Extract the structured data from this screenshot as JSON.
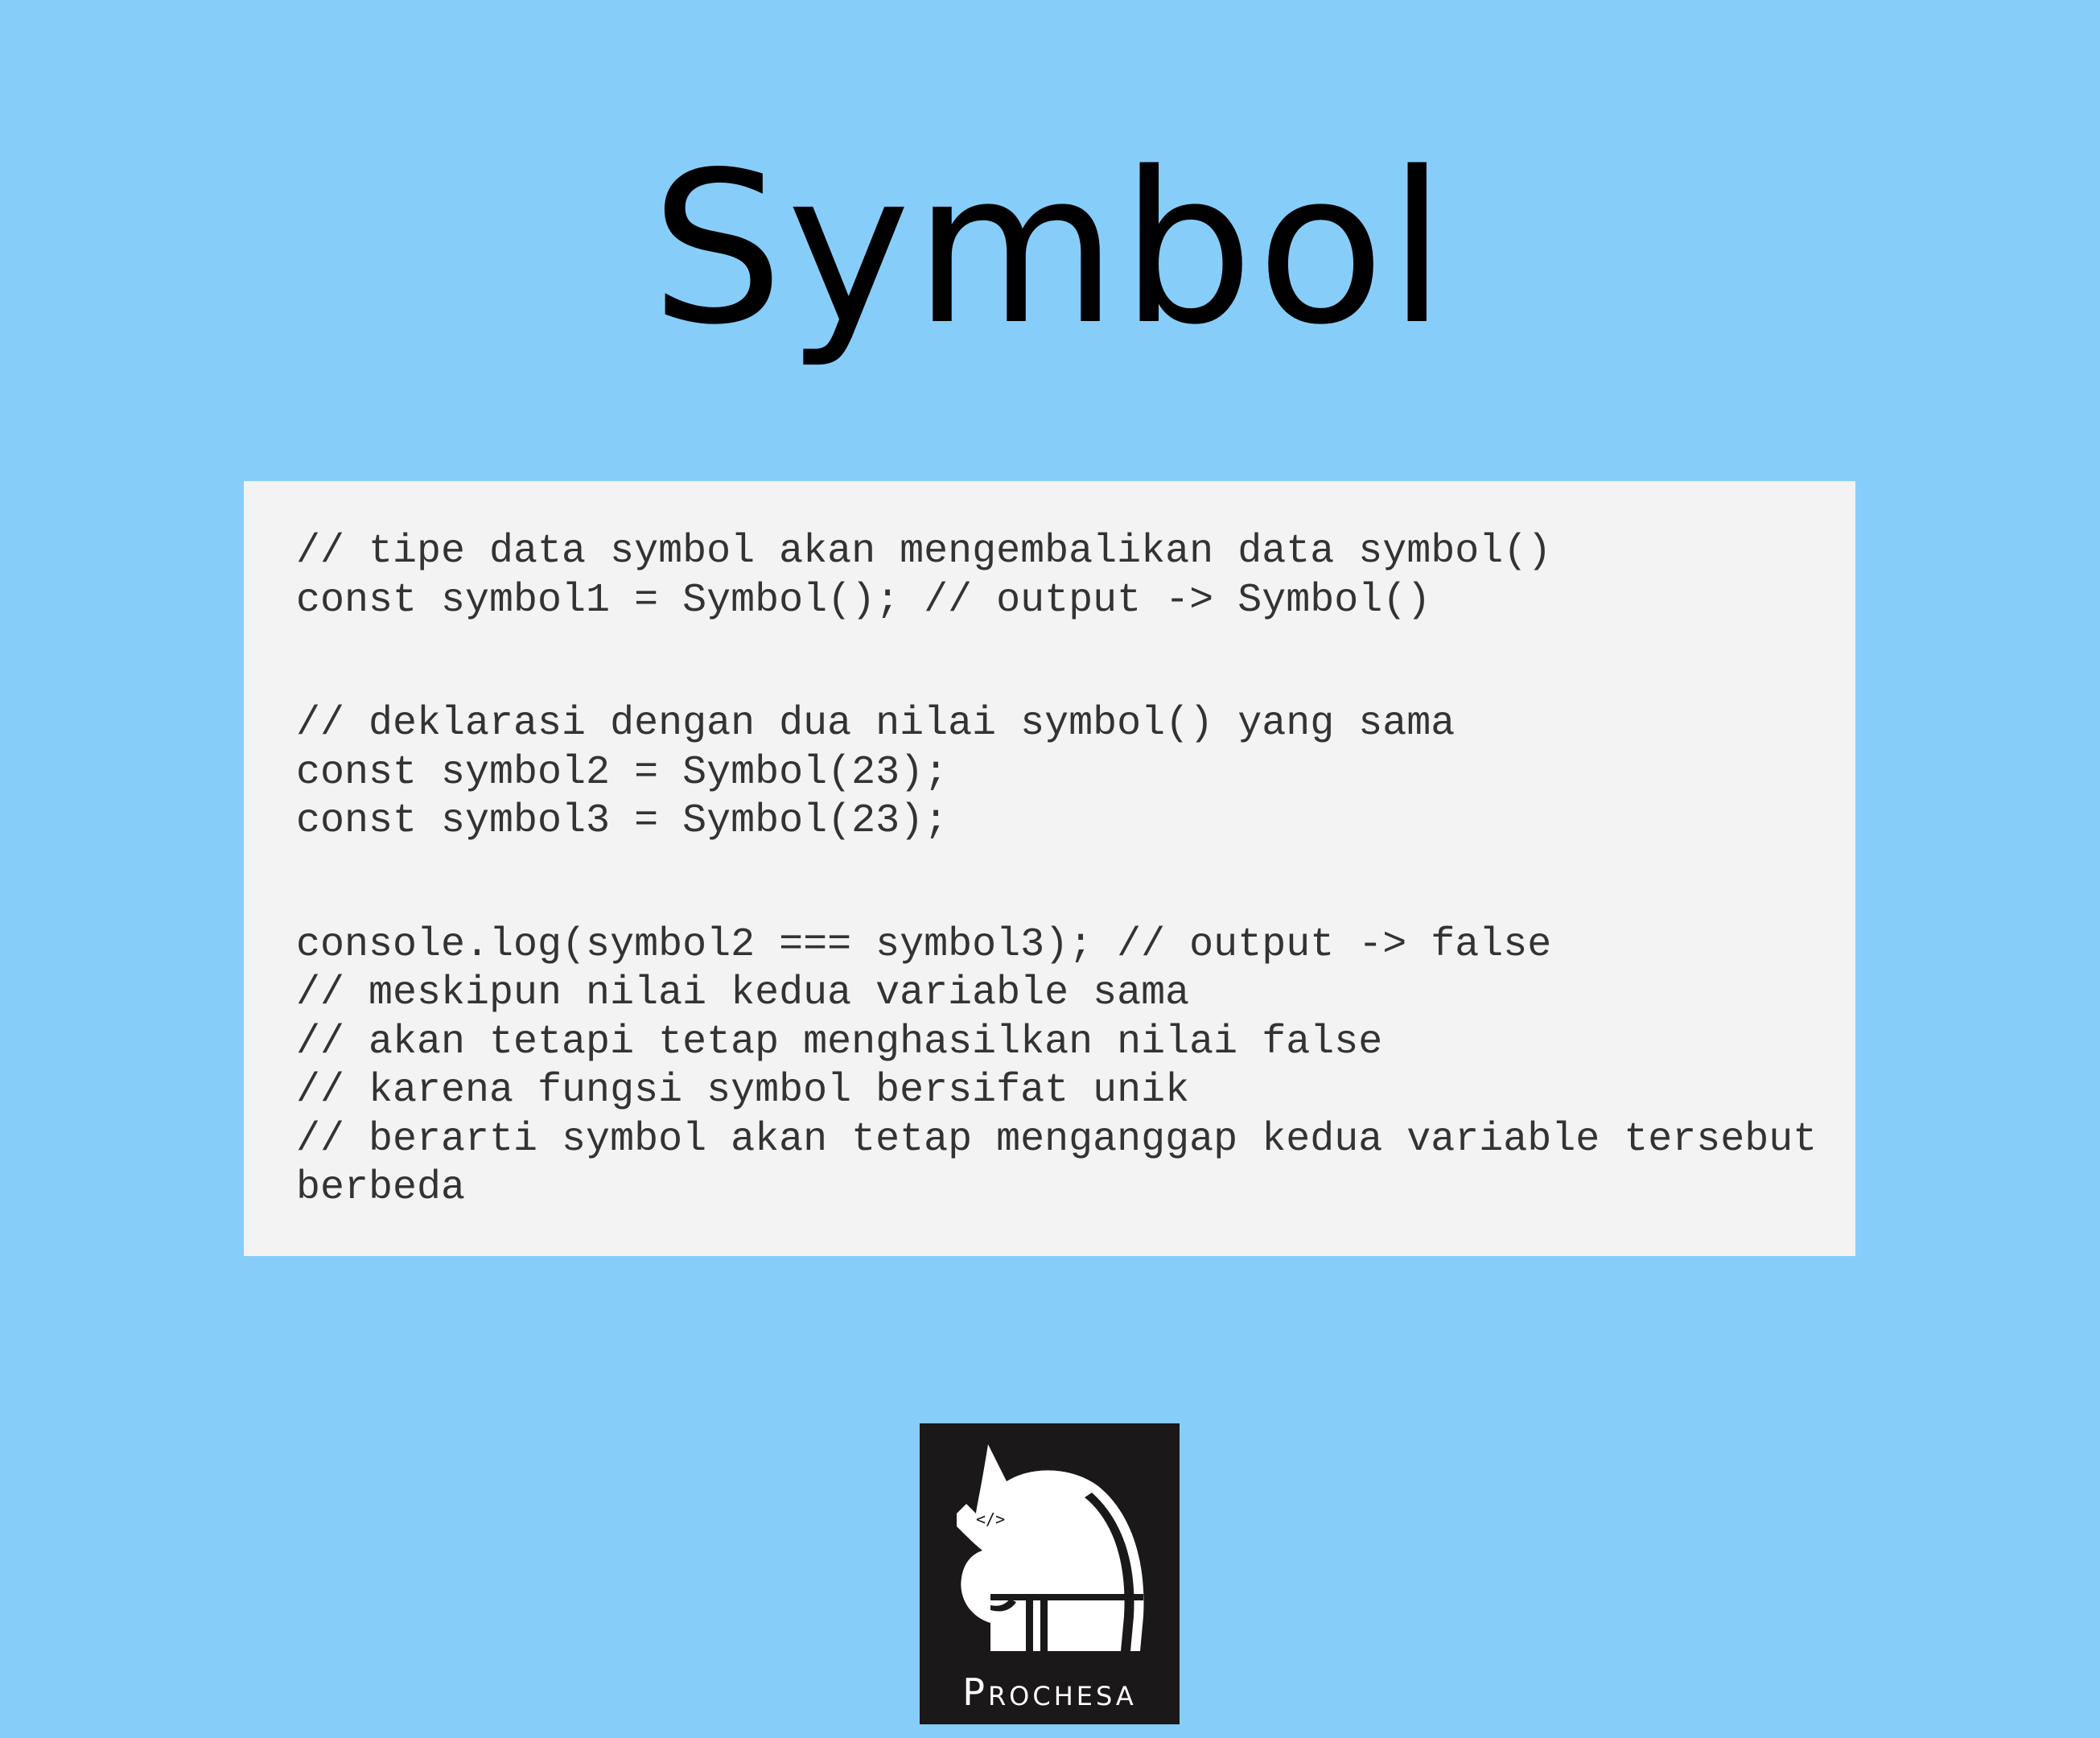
{
  "title": "Symbol",
  "code_block": {
    "lines": [
      "// tipe data symbol akan mengembalikan data symbol()",
      "const symbol1 = Symbol(); // output -> Symbol()",
      "// deklarasi dengan dua nilai symbol() yang sama",
      "const symbol2 = Symbol(23);",
      "const symbol3 = Symbol(23);",
      "console.log(symbol2 === symbol3); // output -> false",
      "// meskipun nilai kedua variable sama",
      "// akan tetapi tetap menghasilkan nilai false",
      "// karena fungsi symbol bersifat unik",
      "// berarti symbol akan tetap menganggap kedua variable tersebut",
      "berbeda"
    ]
  },
  "logo": {
    "icon": "knight-chess-piece-icon",
    "text": "Prochesa",
    "face_mark": "</>",
    "background": "#1a1818"
  },
  "colors": {
    "page_background": "#87cdfa",
    "code_background": "#f3f3f3",
    "code_text": "#333333"
  }
}
